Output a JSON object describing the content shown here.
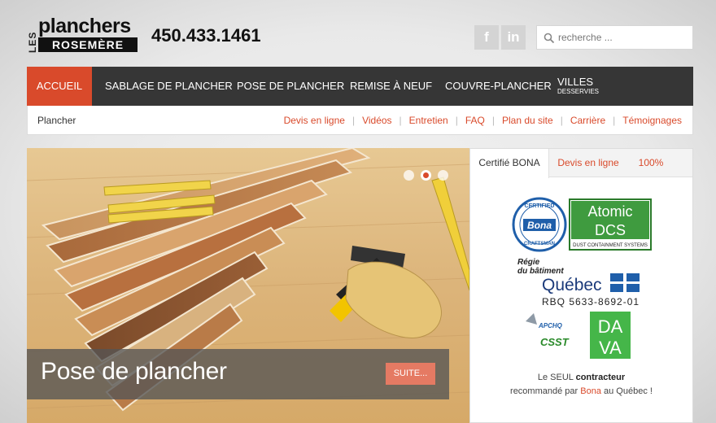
{
  "logo": {
    "les": "LES",
    "planchers": "planchers",
    "rosemere": "ROSEMÈRE"
  },
  "phone": "450.433.1461",
  "social": {
    "facebook": "f",
    "linkedin": "in"
  },
  "search": {
    "placeholder": "recherche ..."
  },
  "nav": {
    "items": [
      "ACCUEIL",
      "SABLAGE DE PLANCHER",
      "POSE DE PLANCHER",
      "REMISE À NEUF",
      "COUVRE-PLANCHER"
    ],
    "villes": "VILLES",
    "villes_sub": "DESSERVIES"
  },
  "breadcrumb": "Plancher",
  "sublinks": [
    "Devis en ligne",
    "Vidéos",
    "Entretien",
    "FAQ",
    "Plan du site",
    "Carrière",
    "Témoignages"
  ],
  "slider": {
    "title": "Pose de plancher",
    "button": "SUITE...",
    "slide_count": 3,
    "active_slide": 2
  },
  "panel": {
    "tabs": [
      "Certifié BONA",
      "Devis en ligne",
      "100%"
    ],
    "bona": {
      "line1": "CERTIFIED",
      "brand": "Bona",
      "line2": "CRAFTSMAN"
    },
    "atomic": {
      "title": "Atomic",
      "dcs": "DCS",
      "sub": "DUST CONTAINMENT SYSTEMS"
    },
    "rbq": {
      "regie": "Régie",
      "batiment": "du bâtiment",
      "quebec": "Québec",
      "number": "RBQ 5633-8692-01"
    },
    "apchq": "APCHQ",
    "csst": "CSST",
    "dava": {
      "top": "DA",
      "bottom": "VA"
    },
    "claim": {
      "pre": "Le SEUL",
      "bold": "contracteur",
      "mid": "recommandé par",
      "brand": "Bona",
      "post": "au Québec !"
    }
  },
  "colors": {
    "accent": "#d94a2b",
    "nav_bg": "#363636",
    "dava_green": "#45b649",
    "bona_blue": "#1f5faa"
  }
}
